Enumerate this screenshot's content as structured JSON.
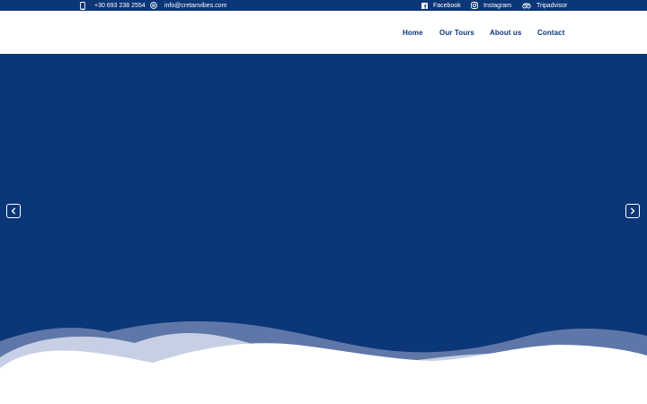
{
  "colors": {
    "brand_blue": "#0b3677",
    "wave_mid": "#5f77a8",
    "wave_light": "#c6cfe3",
    "white": "#ffffff"
  },
  "topbar": {
    "phone": {
      "icon": "mobile-phone-icon",
      "text": "+30 693 238 2554"
    },
    "email": {
      "icon": "at-sign-icon",
      "text": "info@cretanvibes.com"
    },
    "social": [
      {
        "icon": "facebook-icon",
        "label": "Facebook"
      },
      {
        "icon": "instagram-icon",
        "label": "Instagram"
      },
      {
        "icon": "tripadvisor-icon",
        "label": "Tripadvisor"
      }
    ]
  },
  "nav": {
    "items": [
      {
        "label": "Home"
      },
      {
        "label": "Our Tours"
      },
      {
        "label": "About us"
      },
      {
        "label": "Contact"
      }
    ]
  },
  "slider": {
    "prev_icon": "chevron-left-icon",
    "next_icon": "chevron-right-icon"
  }
}
